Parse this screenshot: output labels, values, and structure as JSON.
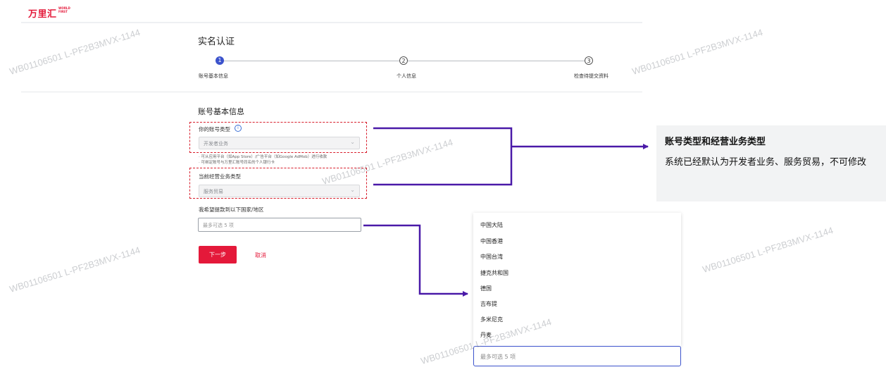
{
  "header": {
    "logo_cn": "万里汇",
    "logo_en": "WORLD FIRST"
  },
  "page_title": "实名认证",
  "steps": [
    {
      "number": "1",
      "label": "账号基本信息",
      "state": "active"
    },
    {
      "number": "2",
      "label": "个人信息",
      "state": "pending"
    },
    {
      "number": "3",
      "label": "检查待提交资料",
      "state": "pending"
    }
  ],
  "form": {
    "section_title": "账号基本信息",
    "account_type": {
      "label": "你的账号类型",
      "info_icon": "i",
      "value": "开发者业务",
      "hints": [
        "· 可从应用平台（如App Store）/广告平台（如Google AdMob）进行收款",
        "· 可绑定账号与万里汇账号同名的个人银行卡"
      ]
    },
    "business_type": {
      "label": "当前经营业务类型",
      "value": "服务贸易"
    },
    "withdraw_region": {
      "label": "我希望提款到以下国家/地区",
      "placeholder": "最多可选 5 项"
    },
    "next_label": "下一步",
    "cancel_label": "取消"
  },
  "callout": {
    "title": "账号类型和经营业务类型",
    "body": "系统已经默认为开发者业务、服务贸易，不可修改"
  },
  "dropdown": {
    "options": [
      "中国大陆",
      "中国香港",
      "中国台湾",
      "捷克共和国",
      "德国",
      "吉布提",
      "多米尼克",
      "丹麦"
    ],
    "search_placeholder": "最多可选 5 项"
  },
  "watermark": "WB01106501 L-PF2B3MVX-1144",
  "colors": {
    "brand": "#e4193a",
    "accent": "#3b52cc",
    "connector": "#4a1aa8",
    "highlight": "#d81e2c"
  }
}
